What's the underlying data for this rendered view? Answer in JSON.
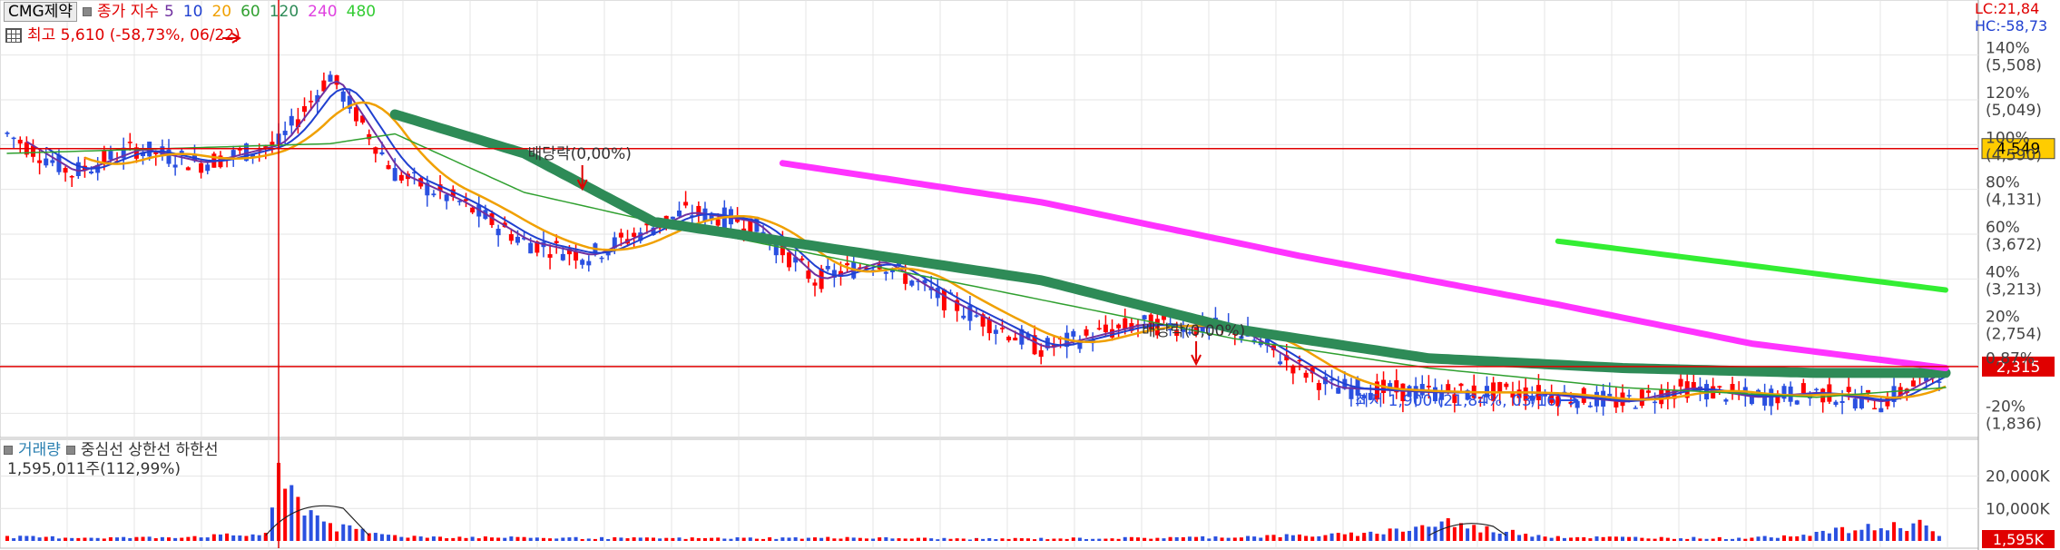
{
  "header": {
    "stock_name": "CMG제약",
    "price_label": "종가 지수",
    "ma_periods": [
      "5",
      "10",
      "20",
      "60",
      "120",
      "240",
      "480"
    ],
    "high_note": "최고 5,610 (-58,73%, 06/22)",
    "lc_label": "LC:21,84",
    "hc_label": "HC:-58,73"
  },
  "volume_header": {
    "volume_label": "거래량",
    "lines_label": "중심선  상한선  하한선",
    "volume_value": "1,595,011주(112,99%)"
  },
  "annotations": {
    "dividend1": "배당락(0,00%)",
    "dividend2": "배당락(0,00%)",
    "low_note": "최저 1,900 (21,84%, 03/16)"
  },
  "colors": {
    "ma5": "#7030a0",
    "ma10": "#2040d0",
    "ma20": "#f0a000",
    "ma60": "#30a030",
    "ma120": "#2e8b57",
    "ma240": "#ff33ff",
    "ma480": "#33ee33",
    "candle_up": "#ff0000",
    "candle_down": "#2a50e0",
    "ref_line": "#e00000"
  },
  "chart_data": [
    {
      "type": "line",
      "title": "CMG제약",
      "y_axis_ticks": [
        {
          "pct": "140%",
          "price": "(5,508)"
        },
        {
          "pct": "120%",
          "price": "(5,049)"
        },
        {
          "pct": "100%",
          "price": "(4,590)"
        },
        {
          "pct": "80%",
          "price": "(4,131)"
        },
        {
          "pct": "60%",
          "price": "(3,672)"
        },
        {
          "pct": "40%",
          "price": "(3,213)"
        },
        {
          "pct": "20%",
          "price": "(2,754)"
        },
        {
          "pct": "0,87%",
          "price": ""
        },
        {
          "pct": "-20%",
          "price": "(1,836)"
        }
      ],
      "ylim": [
        1700,
        5700
      ],
      "current_price": "2,315",
      "crosshair_price": "4,549",
      "max_price": 5610,
      "min_price": 1900,
      "price_x": [
        0,
        10,
        20,
        30,
        42,
        50,
        56,
        60,
        70,
        80,
        90,
        105,
        115,
        125,
        135,
        145,
        160,
        175,
        190,
        205,
        220,
        235,
        250,
        260,
        270,
        280,
        290,
        300
      ],
      "price_close": [
        4700,
        4300,
        4550,
        4400,
        4600,
        5300,
        4700,
        4300,
        4000,
        3600,
        3450,
        3900,
        3800,
        3200,
        3400,
        3000,
        2500,
        2750,
        2700,
        2100,
        2050,
        2050,
        1950,
        2100,
        2000,
        2050,
        1950,
        2300
      ],
      "ma60": {
        "x": [
          0,
          50,
          60,
          80,
          100,
          130,
          160,
          190,
          220,
          250,
          280,
          300
        ],
        "y": [
          4500,
          4600,
          4700,
          4100,
          3800,
          3400,
          3000,
          2600,
          2300,
          2100,
          2000,
          2100
        ]
      },
      "ma120": {
        "x": [
          60,
          80,
          100,
          130,
          160,
          190,
          220,
          250,
          280,
          300
        ],
        "y": [
          4900,
          4500,
          3800,
          3500,
          3200,
          2700,
          2400,
          2300,
          2250,
          2250
        ]
      },
      "ma240": {
        "x": [
          120,
          160,
          200,
          240,
          270,
          300
        ],
        "y": [
          4400,
          4000,
          3450,
          2950,
          2550,
          2300
        ]
      },
      "ma480": {
        "x": [
          240,
          300
        ],
        "y": [
          3600,
          3100
        ]
      }
    },
    {
      "type": "bar",
      "title": "거래량",
      "y_axis_ticks": [
        "20,000K",
        "10,000K"
      ],
      "ylim": [
        0,
        28000
      ],
      "current_volume": "1,595K",
      "x": [
        0,
        20,
        40,
        42,
        50,
        60,
        80,
        100,
        130,
        150,
        180,
        210,
        223,
        225,
        240,
        270,
        296,
        298
      ],
      "values": [
        1500,
        1200,
        2500,
        22000,
        5500,
        1800,
        1200,
        1000,
        1200,
        800,
        1200,
        2500,
        7000,
        5500,
        1500,
        1000,
        6500,
        3000
      ]
    }
  ]
}
